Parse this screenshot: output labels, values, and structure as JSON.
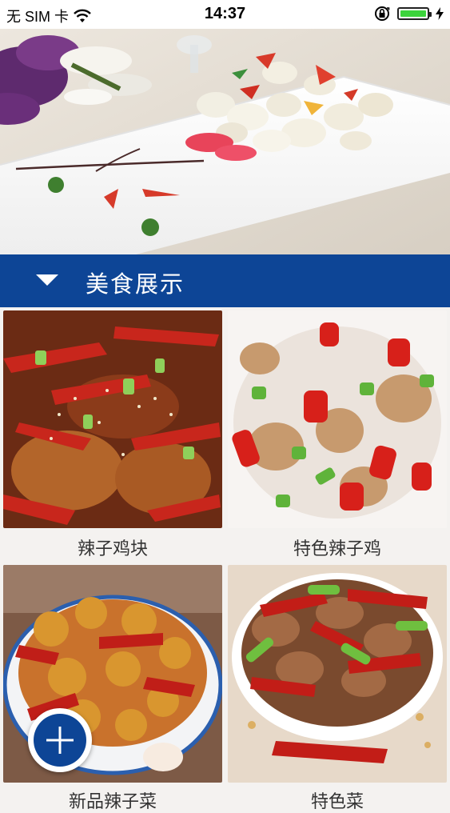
{
  "status_bar": {
    "carrier": "无 SIM 卡",
    "time": "14:37",
    "battery_level": 1.0
  },
  "hero": {
    "icon": "hero-dish-photo"
  },
  "section": {
    "title": "美食展示",
    "arrow_icon": "triangle-down-icon",
    "color": "#0d4596"
  },
  "dishes": [
    {
      "name": "辣子鸡块"
    },
    {
      "name": "特色辣子鸡"
    },
    {
      "name": "新品辣子菜"
    },
    {
      "name": "特色菜"
    }
  ],
  "fab": {
    "icon": "plus-icon",
    "color": "#0d4596"
  }
}
